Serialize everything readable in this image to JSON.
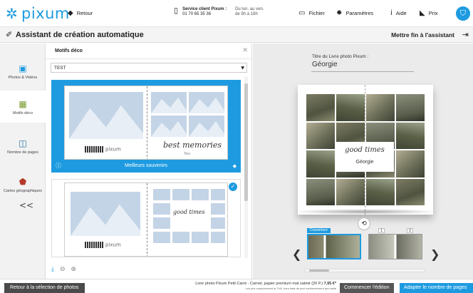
{
  "header": {
    "logo_text": "pixum",
    "back_label": "Retour",
    "service_title": "Service client Pixum :",
    "service_phone": "01 70 65 35 36",
    "service_hours_1": "Du lun. au ven.",
    "service_hours_2": "de 9h à 18h",
    "file_label": "Fichier",
    "settings_label": "Paramètres",
    "help_label": "Aide",
    "price_label": "Prix"
  },
  "titlebar": {
    "title": "Assistant de création automatique",
    "end_label": "Mettre fin à l'assistant"
  },
  "sidebar": {
    "items": [
      {
        "label": "Photos & Vidéos",
        "icon": "image-icon"
      },
      {
        "label": "Motifs déco",
        "icon": "layout-icon"
      },
      {
        "label": "Nombre de pages",
        "icon": "pages-icon"
      },
      {
        "label": "Cartes géographiques",
        "icon": "map-icon"
      }
    ],
    "collapse_label": "<<"
  },
  "panel": {
    "title": "Motifs déco",
    "select_value": "TEST",
    "card1_footer": "Meilleurs souvenirs",
    "card1_script": "best memories",
    "card1_subtitle": "Titre",
    "card2_script": "good times",
    "brand_text": "pixum",
    "accent_color": "#1e9be0"
  },
  "preview": {
    "book_title_label": "Titre du Livre photo Pixum :",
    "book_title_value": "Géorgie",
    "cover_script": "good times",
    "cover_name": "Géorgie",
    "thumb_cover_label": "Couverture",
    "thumb_page_1": "1",
    "thumb_page_2": "2"
  },
  "footer": {
    "back_to_photos": "Retour à la sélection de photos",
    "product_line": "Livre photo Pixum Petit Carré - Carnet, papier premium mat satiné (26 P.)",
    "price": "7,95 €*",
    "fine_print": "Les prix comprennent la TVA, hors frais de port conformément aux tarifs",
    "start_edit": "Commencer l'édition",
    "adjust_pages": "Adapter le nombre de pages"
  }
}
